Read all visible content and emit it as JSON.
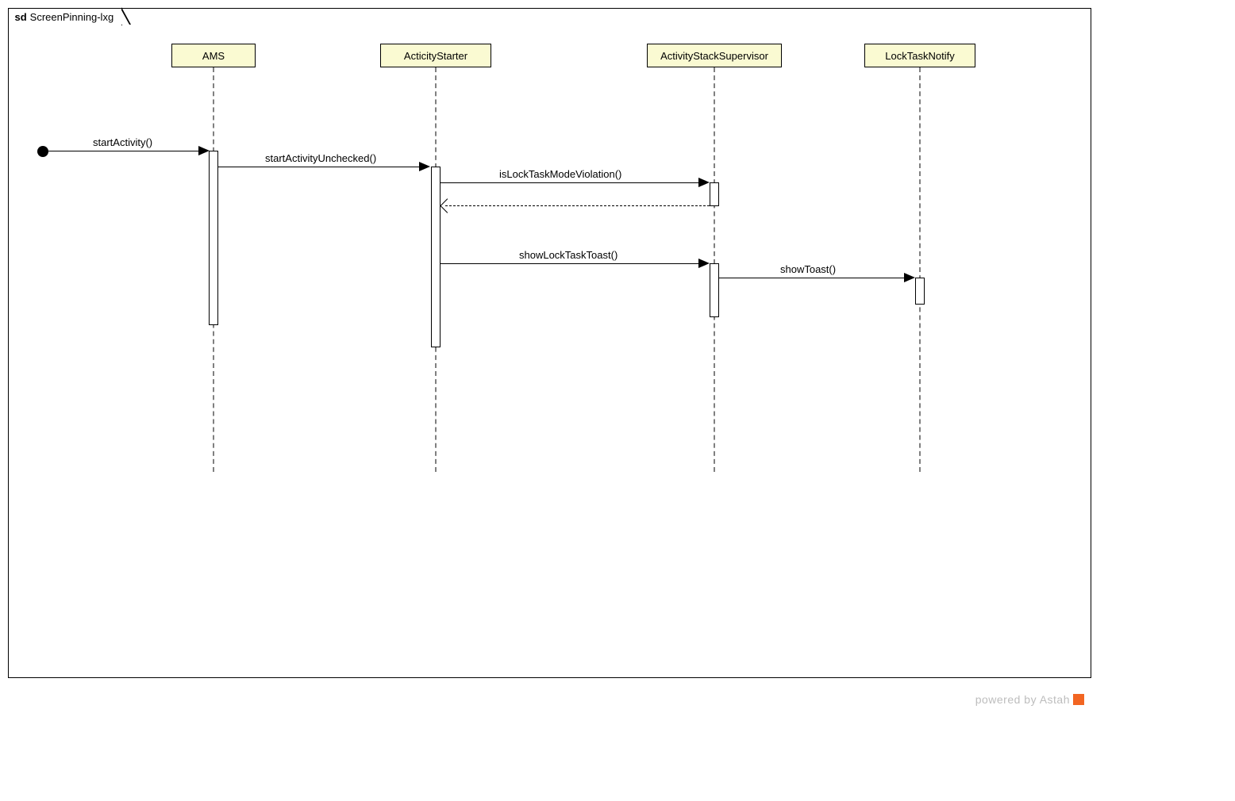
{
  "frame": {
    "prefix": "sd",
    "name": "ScreenPinning-lxg"
  },
  "lifelines": {
    "ams": "AMS",
    "starter": "ActicityStarter",
    "supervisor": "ActivityStackSupervisor",
    "notify": "LockTaskNotify"
  },
  "messages": {
    "startActivity": "startActivity()",
    "startActivityUnchecked": "startActivityUnchecked()",
    "isLockTaskModeViolation": "isLockTaskModeViolation()",
    "showLockTaskToast": "showLockTaskToast()",
    "showToast": "showToast()"
  },
  "watermark": "powered by Astah",
  "chart_data": {
    "type": "uml-sequence",
    "frame": "sd ScreenPinning-lxg",
    "lifelines": [
      "AMS",
      "ActicityStarter",
      "ActivityStackSupervisor",
      "LockTaskNotify"
    ],
    "messages": [
      {
        "from": "(found)",
        "to": "AMS",
        "label": "startActivity()",
        "kind": "sync"
      },
      {
        "from": "AMS",
        "to": "ActicityStarter",
        "label": "startActivityUnchecked()",
        "kind": "sync"
      },
      {
        "from": "ActicityStarter",
        "to": "ActivityStackSupervisor",
        "label": "isLockTaskModeViolation()",
        "kind": "sync"
      },
      {
        "from": "ActivityStackSupervisor",
        "to": "ActicityStarter",
        "label": "",
        "kind": "return"
      },
      {
        "from": "ActicityStarter",
        "to": "ActivityStackSupervisor",
        "label": "showLockTaskToast()",
        "kind": "sync"
      },
      {
        "from": "ActivityStackSupervisor",
        "to": "LockTaskNotify",
        "label": "showToast()",
        "kind": "sync"
      }
    ]
  }
}
